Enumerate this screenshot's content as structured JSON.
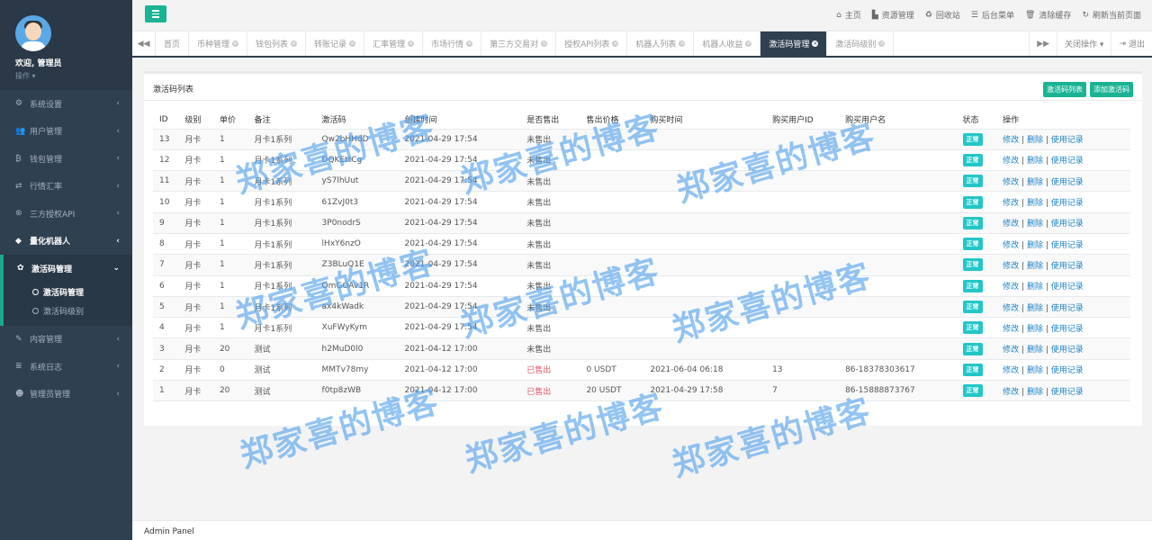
{
  "profile": {
    "welcome": "欢迎, 管理员",
    "operation": "操作 ▾"
  },
  "sidebar": {
    "items": [
      {
        "label": "系统设置",
        "icon": "gears-icon",
        "glyph": "⚙"
      },
      {
        "label": "用户管理",
        "icon": "users-icon",
        "glyph": "👥"
      },
      {
        "label": "钱包管理",
        "icon": "bitcoin-icon",
        "glyph": "₿"
      },
      {
        "label": "行情汇率",
        "icon": "exchange-icon",
        "glyph": "⇄"
      },
      {
        "label": "三方授权API",
        "icon": "api-icon",
        "glyph": "⊛"
      },
      {
        "label": "量化机器人",
        "icon": "robot-icon",
        "glyph": "◆"
      }
    ],
    "active_group": {
      "label": "激活码管理",
      "icon": "gear-icon",
      "glyph": "✿",
      "subitems": [
        {
          "label": "激活码管理"
        },
        {
          "label": "激活码级别"
        }
      ]
    },
    "items_after": [
      {
        "label": "内容管理",
        "icon": "edit-icon",
        "glyph": "✎"
      },
      {
        "label": "系统日志",
        "icon": "log-icon",
        "glyph": "≣"
      },
      {
        "label": "管理员管理",
        "icon": "admin-icon",
        "glyph": "☻"
      }
    ]
  },
  "topbar": {
    "links": [
      {
        "label": "主页",
        "icon": "home-icon",
        "glyph": "⌂"
      },
      {
        "label": "资源管理",
        "icon": "file-icon",
        "glyph": "▙"
      },
      {
        "label": "回收站",
        "icon": "recycle-icon",
        "glyph": "♻"
      },
      {
        "label": "后台菜单",
        "icon": "list-icon",
        "glyph": "☰"
      },
      {
        "label": "清除缓存",
        "icon": "trash-icon",
        "glyph": "🗑"
      },
      {
        "label": "刷新当前页面",
        "icon": "refresh-icon",
        "glyph": "↻"
      }
    ]
  },
  "tabs": [
    "首页",
    "币种管理",
    "钱包列表",
    "转账记录",
    "汇率管理",
    "市场行情",
    "第三方交易对",
    "授权API列表",
    "机器人列表",
    "机器人收益",
    "激活码管理",
    "激活码级别"
  ],
  "active_tab": 10,
  "tab_right": {
    "close_ops": "关闭操作 ▾",
    "logout": "退出"
  },
  "panel": {
    "title": "激活码列表",
    "btn_list": "激活码列表",
    "btn_add": "添加激活码"
  },
  "table": {
    "headers": [
      "ID",
      "级别",
      "单价",
      "备注",
      "激活码",
      "创建时间",
      "是否售出",
      "售出价格",
      "购买时间",
      "购买用户ID",
      "购买用户名",
      "状态",
      "操作"
    ],
    "rows": [
      [
        "13",
        "月卡",
        "1",
        "月卡1系列",
        "Qw2bHHdD",
        "2021-04-29 17:54",
        "未售出",
        "",
        "",
        "",
        "",
        "正常"
      ],
      [
        "12",
        "月卡",
        "1",
        "月卡1系列",
        "DQKEttCg",
        "2021-04-29 17:54",
        "未售出",
        "",
        "",
        "",
        "",
        "正常"
      ],
      [
        "11",
        "月卡",
        "1",
        "月卡1系列",
        "yS7lhUut",
        "2021-04-29 17:54",
        "未售出",
        "",
        "",
        "",
        "",
        "正常"
      ],
      [
        "10",
        "月卡",
        "1",
        "月卡1系列",
        "61ZvJ0t3",
        "2021-04-29 17:54",
        "未售出",
        "",
        "",
        "",
        "",
        "正常"
      ],
      [
        "9",
        "月卡",
        "1",
        "月卡1系列",
        "3P0nodrS",
        "2021-04-29 17:54",
        "未售出",
        "",
        "",
        "",
        "",
        "正常"
      ],
      [
        "8",
        "月卡",
        "1",
        "月卡1系列",
        "lHxY6nzO",
        "2021-04-29 17:54",
        "未售出",
        "",
        "",
        "",
        "",
        "正常"
      ],
      [
        "7",
        "月卡",
        "1",
        "月卡1系列",
        "Z3BLuQ1E",
        "2021-04-29 17:54",
        "未售出",
        "",
        "",
        "",
        "",
        "正常"
      ],
      [
        "6",
        "月卡",
        "1",
        "月卡1系列",
        "OmGOAv1R",
        "2021-04-29 17:54",
        "未售出",
        "",
        "",
        "",
        "",
        "正常"
      ],
      [
        "5",
        "月卡",
        "1",
        "月卡1系列",
        "ax4kWadk",
        "2021-04-29 17:54",
        "未售出",
        "",
        "",
        "",
        "",
        "正常"
      ],
      [
        "4",
        "月卡",
        "1",
        "月卡1系列",
        "XuFWyKym",
        "2021-04-29 17:54",
        "未售出",
        "",
        "",
        "",
        "",
        "正常"
      ],
      [
        "3",
        "月卡",
        "20",
        "测试",
        "h2MuD0l0",
        "2021-04-12 17:00",
        "未售出",
        "",
        "",
        "",
        "",
        "正常"
      ],
      [
        "2",
        "月卡",
        "0",
        "测试",
        "MMTv78my",
        "2021-04-12 17:00",
        "已售出",
        "0 USDT",
        "2021-06-04 06:18",
        "13",
        "86-18378303617",
        "正常"
      ],
      [
        "1",
        "月卡",
        "20",
        "测试",
        "f0tp8zWB",
        "2021-04-12 17:00",
        "已售出",
        "20 USDT",
        "2021-04-29 17:58",
        "7",
        "86-15888873767",
        "正常"
      ]
    ],
    "ops": {
      "edit": "修改",
      "del": "删除",
      "log": "使用记录",
      "sep": " | "
    }
  },
  "footer": "Admin Panel",
  "watermark": "郑家喜的博客",
  "colors": {
    "sidebar": "#2f4050",
    "accent": "#1ab394",
    "badge": "#23c6c8",
    "sold": "#ed5565",
    "link": "#1c84c6"
  }
}
